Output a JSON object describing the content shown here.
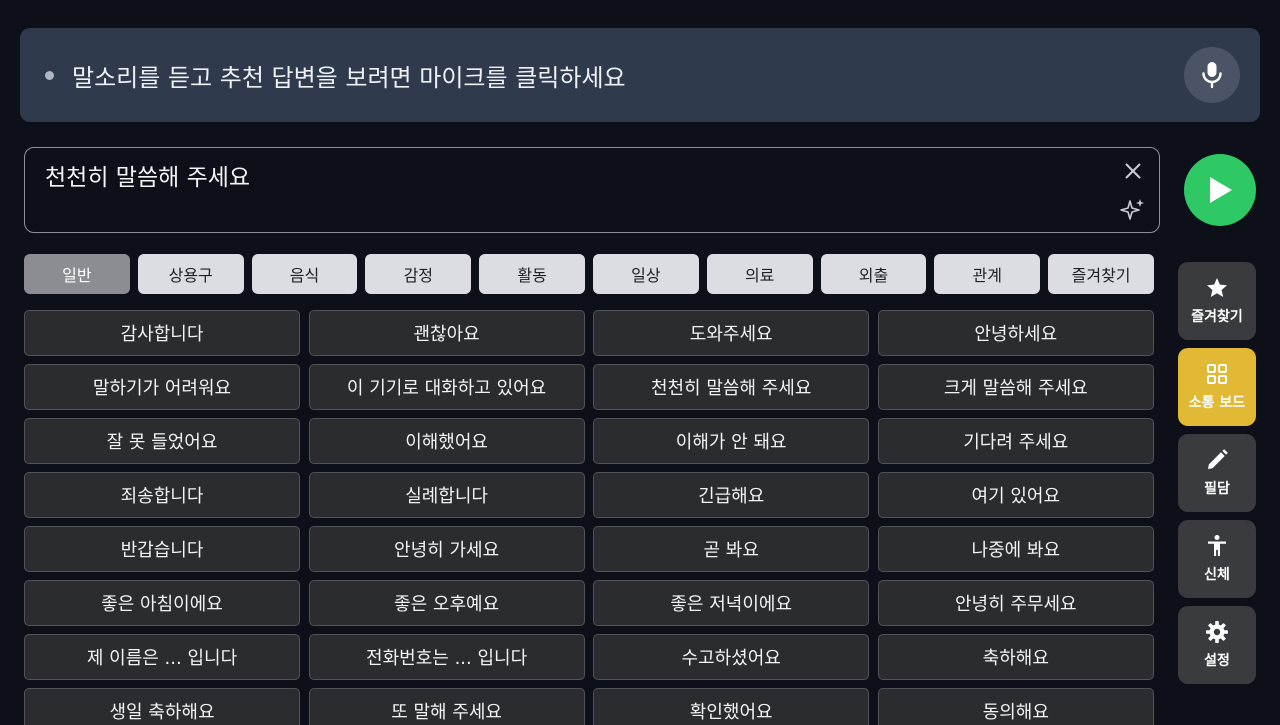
{
  "listen": {
    "prompt": "말소리를 듣고 추천 답변을 보려면 마이크를 클릭하세요",
    "mic_icon": "microphone-icon"
  },
  "input": {
    "value": "천천히 말씀해 주세요",
    "clear_icon": "close-icon",
    "suggest_icon": "sparkle-icon"
  },
  "play": {
    "icon": "play-icon",
    "color": "#2ec865"
  },
  "tabs": [
    {
      "label": "일반",
      "active": true
    },
    {
      "label": "상용구"
    },
    {
      "label": "음식"
    },
    {
      "label": "감정"
    },
    {
      "label": "활동"
    },
    {
      "label": "일상"
    },
    {
      "label": "의료"
    },
    {
      "label": "외출"
    },
    {
      "label": "관계"
    },
    {
      "label": "즐겨찾기"
    }
  ],
  "phrases": [
    "감사합니다",
    "괜찮아요",
    "도와주세요",
    "안녕하세요",
    "말하기가 어려워요",
    "이 기기로 대화하고 있어요",
    "천천히 말씀해 주세요",
    "크게 말씀해 주세요",
    "잘 못 들었어요",
    "이해했어요",
    "이해가 안 돼요",
    "기다려 주세요",
    "죄송합니다",
    "실례합니다",
    "긴급해요",
    "여기 있어요",
    "반갑습니다",
    "안녕히 가세요",
    "곧 봐요",
    "나중에 봐요",
    "좋은 아침이에요",
    "좋은 오후예요",
    "좋은 저녁이에요",
    "안녕히 주무세요",
    "제 이름은 ... 입니다",
    "전화번호는 ... 입니다",
    "수고하셨어요",
    "축하해요",
    "생일 축하해요",
    "또 말해 주세요",
    "확인했어요",
    "동의해요"
  ],
  "sidebar": {
    "favorites": {
      "label": "즐겨찾기",
      "icon": "star-icon"
    },
    "board": {
      "label": "소통 보드",
      "icon": "grid-icon",
      "active": true,
      "color": "#e2b934"
    },
    "writing": {
      "label": "필담",
      "icon": "pencil-icon"
    },
    "body": {
      "label": "신체",
      "icon": "person-icon"
    },
    "settings": {
      "label": "설정",
      "icon": "gear-icon"
    }
  }
}
